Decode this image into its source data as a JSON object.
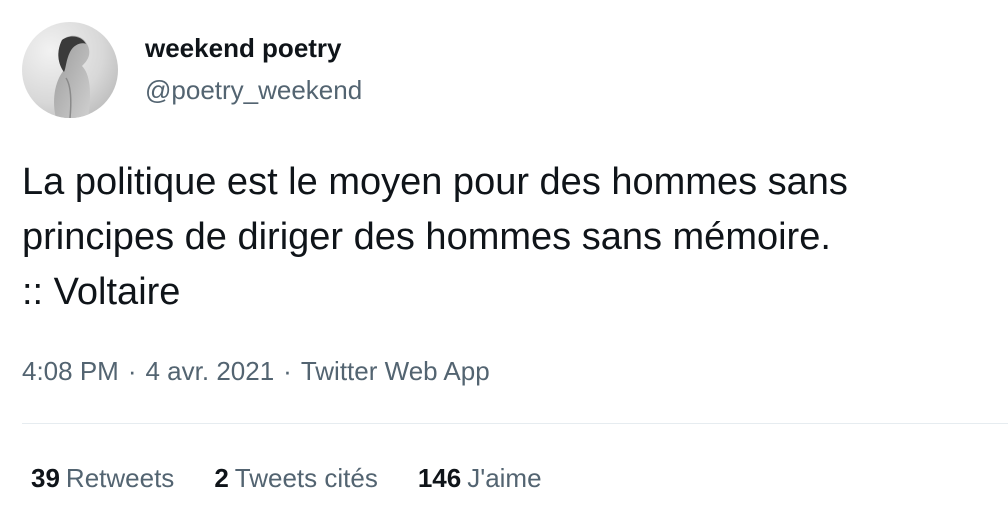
{
  "user": {
    "display_name": "weekend poetry",
    "handle": "@poetry_weekend",
    "avatar_icon": "profile-photo-avatar"
  },
  "tweet": {
    "lines": [
      "La politique est le moyen pour des hommes sans",
      "principes de diriger des hommes sans mémoire.",
      ":: Voltaire"
    ]
  },
  "meta": {
    "time": "4:08 PM",
    "date": "4 avr. 2021",
    "source": "Twitter Web App",
    "separator": "·"
  },
  "stats": {
    "retweets": {
      "count": "39",
      "label": "Retweets"
    },
    "quotes": {
      "count": "2",
      "label": "Tweets cités"
    },
    "likes": {
      "count": "146",
      "label": "J'aime"
    }
  },
  "colors": {
    "text_primary": "#0f1419",
    "text_secondary": "#536471",
    "divider": "#e6ecf0"
  }
}
